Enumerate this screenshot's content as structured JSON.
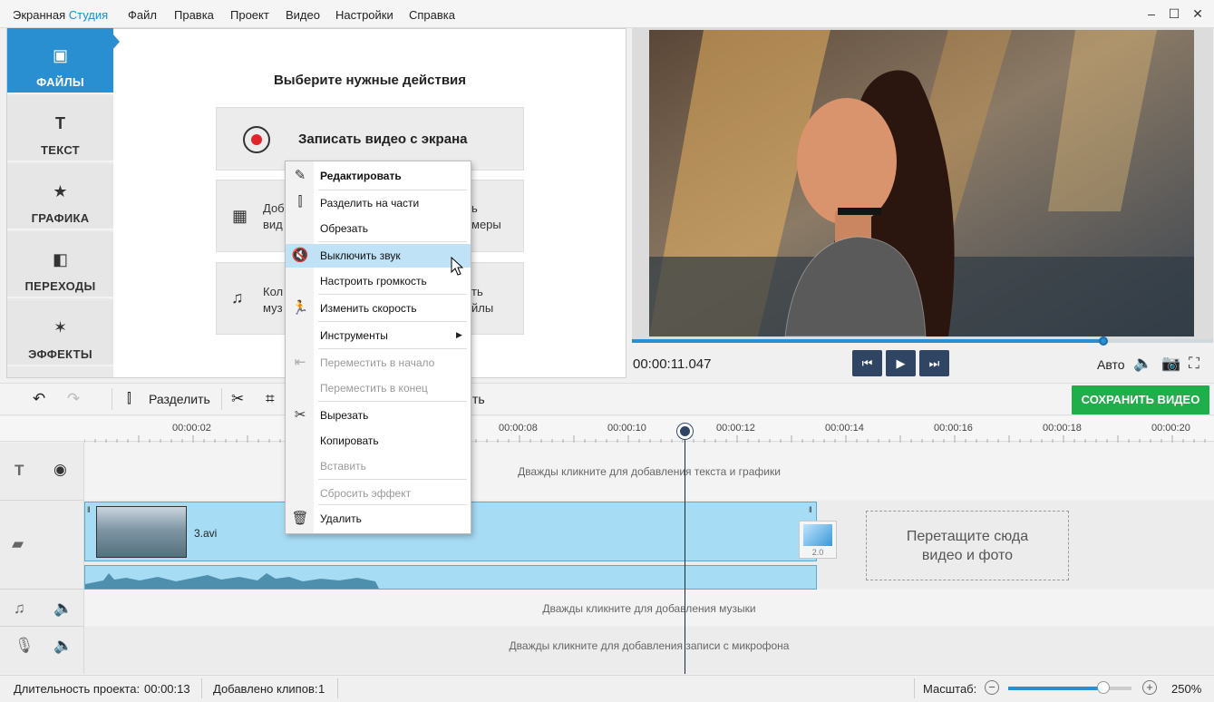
{
  "title_bar": {
    "app_name_1": "Экранная",
    "app_name_2": "Студия",
    "minimize": "–",
    "maximize": "☐",
    "close": "✕"
  },
  "menu": [
    "Файл",
    "Правка",
    "Проект",
    "Видео",
    "Настройки",
    "Справка"
  ],
  "side_tabs": [
    {
      "label": "ФАЙЛЫ",
      "icon": "image-icon",
      "active": true
    },
    {
      "label": "ТЕКСТ",
      "icon": "text-icon"
    },
    {
      "label": "ГРАФИКА",
      "icon": "star-icon"
    },
    {
      "label": "ПЕРЕХОДЫ",
      "icon": "transitions-icon"
    },
    {
      "label": "ЭФФЕКТЫ",
      "icon": "magic-wand-icon"
    }
  ],
  "actions": {
    "title": "Выберите нужные действия",
    "record": "Записать видео с экрана",
    "add_video_1": "Доб",
    "add_video_2": "вид",
    "camera_1": "ь",
    "camera_2": "меры",
    "music_1": "Кол",
    "music_2": "муз",
    "files_1": "ть",
    "files_2": "йлы"
  },
  "player": {
    "timecode": "00:00:11.047",
    "auto": "Авто",
    "progress": 0.81
  },
  "toolbar": {
    "split": "Разделить",
    "partial_label": "ть",
    "save": "СОХРАНИТЬ ВИДЕО"
  },
  "ruler": [
    "00:00:02",
    "00:00:08",
    "00:00:10",
    "00:00:12",
    "00:00:14",
    "00:00:16",
    "00:00:18",
    "00:00:20"
  ],
  "tracks": {
    "text_hint": "Дважды кликните для добавления текста и графики",
    "clip_name": "3.avi",
    "transition_version": "2.0",
    "drop_zone_1": "Перетащите сюда",
    "drop_zone_2": "видео и фото",
    "music_hint": "Дважды кликните для добавления музыки",
    "mic_hint": "Дважды кликните для добавления записи с микрофона"
  },
  "status": {
    "duration_label": "Длительность проекта:",
    "duration": "00:00:13",
    "clips_label": "Добавлено клипов:",
    "clips": "1",
    "zoom_label": "Масштаб:",
    "zoom": "250%",
    "zoom_level": 0.77
  },
  "context_menu": {
    "edit": "Редактировать",
    "split": "Разделить на части",
    "trim": "Обрезать",
    "mute": "Выключить звук",
    "volume": "Настроить громкость",
    "speed": "Изменить скорость",
    "tools": "Инструменты",
    "move_start": "Переместить в начало",
    "move_end": "Переместить в конец",
    "cut": "Вырезать",
    "copy": "Копировать",
    "paste": "Вставить",
    "reset_effect": "Сбросить эффект",
    "delete": "Удалить"
  }
}
